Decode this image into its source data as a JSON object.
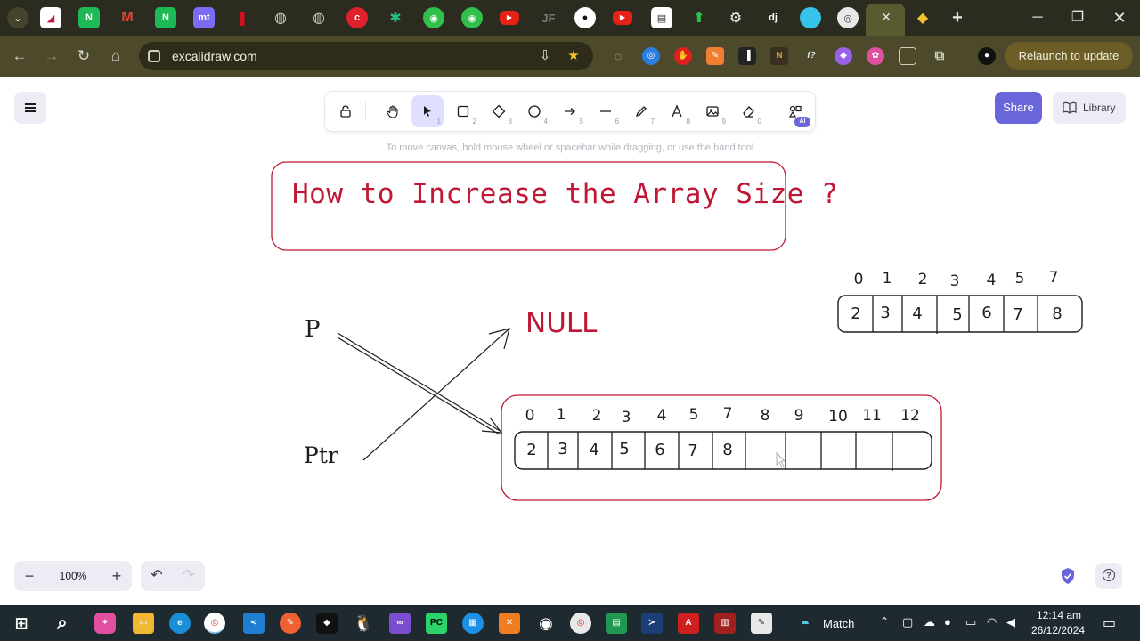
{
  "browser": {
    "url": "excalidraw.com",
    "relaunch_label": "Relaunch to update",
    "tab_icons": [
      "excalidraw-tab",
      "notion-tab",
      "gmail-tab",
      "notion-tab",
      "mt-tab",
      "red-tab",
      "globe-tab",
      "globe-tab",
      "red-circle-tab",
      "perplexity-tab",
      "green-tab",
      "green-tab",
      "youtube-tab",
      "jf-tab",
      "github-tab",
      "youtube-tab",
      "docs-tab",
      "green-arrow-tab",
      "openai-tab",
      "django-tab",
      "blue-circle-tab",
      "chrome-tab",
      "active-tab",
      "python-tab"
    ],
    "active_tab_close": "×",
    "new_tab": "+",
    "tab_letters": {
      "notion": "N",
      "mt": "mt",
      "dj": "dj",
      "jf": "JF"
    }
  },
  "excalidraw": {
    "hint": "To move canvas, hold mouse wheel or spacebar while dragging, or use the hand tool",
    "share_label": "Share",
    "library_label": "Library",
    "zoom_level": "100%",
    "zoom_out": "−",
    "zoom_in": "+",
    "ai_badge": "AI",
    "tools": [
      {
        "name": "lock-tool",
        "key": ""
      },
      {
        "name": "hand-tool",
        "key": ""
      },
      {
        "name": "selection-tool",
        "key": "1"
      },
      {
        "name": "rectangle-tool",
        "key": "2"
      },
      {
        "name": "diamond-tool",
        "key": "3"
      },
      {
        "name": "ellipse-tool",
        "key": "4"
      },
      {
        "name": "arrow-tool",
        "key": "5"
      },
      {
        "name": "line-tool",
        "key": "6"
      },
      {
        "name": "draw-tool",
        "key": "7"
      },
      {
        "name": "text-tool",
        "key": "8"
      },
      {
        "name": "image-tool",
        "key": "9"
      },
      {
        "name": "eraser-tool",
        "key": "0"
      }
    ]
  },
  "drawing": {
    "title": "How to Increase the Array Size ?",
    "null_label": "NULL",
    "p_label": "P",
    "ptr_label": "Ptr",
    "small_array": {
      "indices": [
        "0",
        "1",
        "2",
        "3",
        "4",
        "5",
        "7"
      ],
      "values": [
        "2",
        "3",
        "4",
        "5",
        "6",
        "7",
        "8"
      ]
    },
    "big_array": {
      "indices": [
        "0",
        "1",
        "2",
        "3",
        "4",
        "5",
        "7",
        "8",
        "9",
        "10",
        "11",
        "12"
      ],
      "values": [
        "2",
        "3",
        "4",
        "5",
        "6",
        "7",
        "8",
        "",
        "",
        "",
        "",
        ""
      ]
    },
    "colors": {
      "accent": "#c01734",
      "ink": "#1e1e1e",
      "primary": "#6965db"
    }
  },
  "taskbar": {
    "app_label": "Match",
    "time": "12:14 am",
    "date": "26/12/2024"
  }
}
